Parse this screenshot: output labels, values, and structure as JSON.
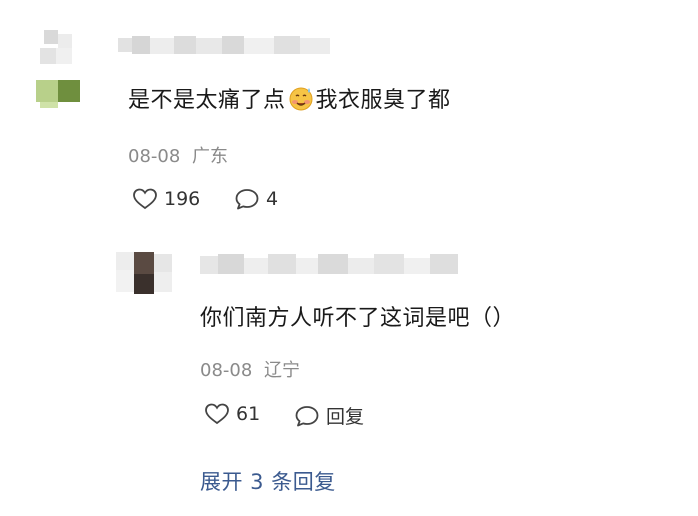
{
  "comments": [
    {
      "text_before": "是不是太痛了点",
      "emoji": "drooling-sweat-face-emoji",
      "text_after": "我衣服臭了都",
      "date": "08-08",
      "location": "广东",
      "likes": "196",
      "replies": "4"
    },
    {
      "text": "你们南方人听不了这词是吧（）",
      "date": "08-08",
      "location": "辽宁",
      "likes": "61",
      "reply_label": "回复"
    }
  ],
  "expand_replies": "展开 3 条回复",
  "icons": {
    "like": "heart-outline-icon",
    "comment": "speech-bubble-icon"
  },
  "colors": {
    "link": "#3b5a8f",
    "meta": "#8a8a8a"
  }
}
